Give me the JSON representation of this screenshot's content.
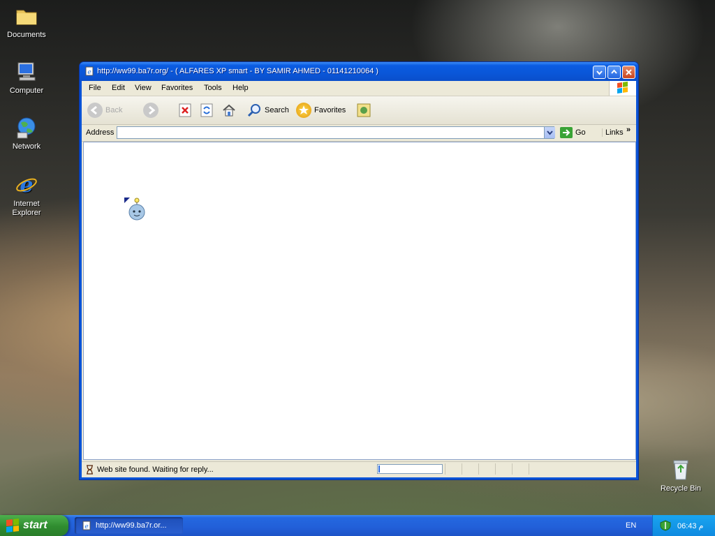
{
  "desktop": {
    "icons": [
      {
        "label": "Documents"
      },
      {
        "label": "Computer"
      },
      {
        "label": "Network"
      },
      {
        "label": "Internet Explorer"
      },
      {
        "label": "Recycle Bin"
      }
    ]
  },
  "window": {
    "title": "http://ww99.ba7r.org/ - ( ALFARES XP smart  -  BY SAMIR AHMED - 01141210064 )",
    "menu": [
      "File",
      "Edit",
      "View",
      "Favorites",
      "Tools",
      "Help"
    ],
    "toolbar": {
      "back_label": "Back",
      "search_label": "Search",
      "favorites_label": "Favorites"
    },
    "address": {
      "label": "Address",
      "value": "",
      "go_label": "Go",
      "links_label": "Links"
    },
    "status": {
      "text": "Web site found. Waiting for reply...",
      "progress_fraction": 0.02
    }
  },
  "taskbar": {
    "start_label": "start",
    "task_label": "http://ww99.ba7r.or...",
    "language": "EN",
    "clock": "06:43 م"
  },
  "colors": {
    "titlebar": "#0a56d8",
    "taskbar": "#225fd8",
    "start_button": "#2f8c2f",
    "tray": "#0f8ae0"
  }
}
